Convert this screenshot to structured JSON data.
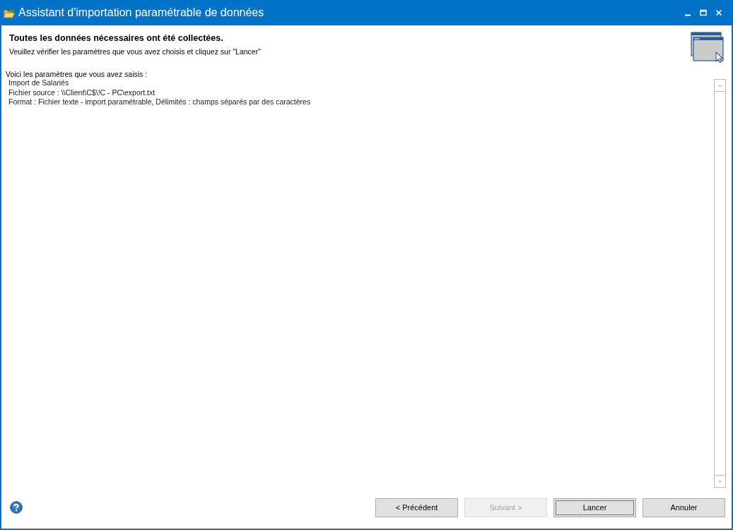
{
  "window": {
    "title": "Assistant d'importation paramétrable de données"
  },
  "header": {
    "title": "Toutes les données nécessaires ont été collectées.",
    "subtitle": "Veuillez vérifier les paramètres que vous avez choisis et cliquez sur \"Lancer\""
  },
  "summary": {
    "intro": "Voici les paramètres que vous avez saisis :",
    "lines": [
      "Import de Salariés",
      "Fichier source : \\\\Client\\C$\\!C - PC\\export.txt",
      "Format : Fichier texte - import paramétrable, Délimités : champs séparés par des caractères"
    ]
  },
  "buttons": [
    {
      "label": "< Précédent",
      "disabled": false,
      "focused": false
    },
    {
      "label": "Suivant >",
      "disabled": true,
      "focused": false
    },
    {
      "label": "Lancer",
      "disabled": false,
      "focused": true
    },
    {
      "label": "Annuler",
      "disabled": false,
      "focused": false
    }
  ]
}
